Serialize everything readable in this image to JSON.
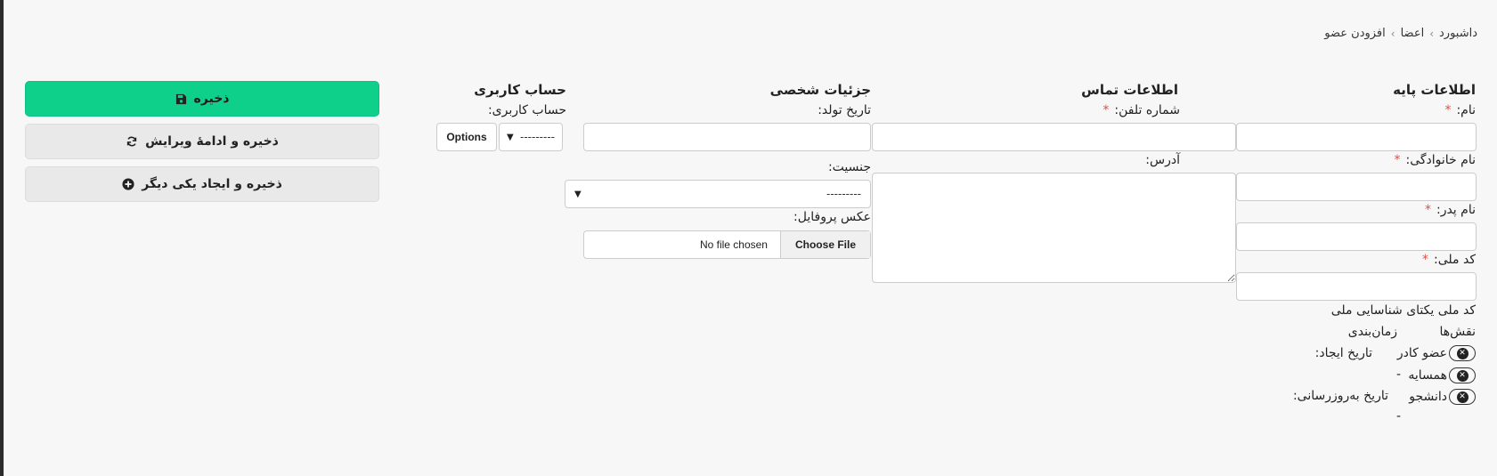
{
  "breadcrumb": {
    "items": [
      "داشبورد",
      "اعضا",
      "افزودن عضو"
    ],
    "separator": "›"
  },
  "sections": {
    "basic": "اطلاعات پایه",
    "contact": "اطلاعات تماس",
    "personal": "جزئیات شخصی",
    "account": "حساب کاربری"
  },
  "fields": {
    "first_name": {
      "label": "نام:",
      "value": ""
    },
    "last_name": {
      "label": "نام خانوادگی:",
      "value": ""
    },
    "father_name": {
      "label": "نام پدر:",
      "value": ""
    },
    "national_code": {
      "label": "کد ملی:",
      "value": "",
      "help": "کد ملی یکتای شناسایی ملی"
    },
    "phone": {
      "label": "شماره تلفن:",
      "value": ""
    },
    "address": {
      "label": "آدرس:",
      "value": ""
    },
    "birth_date": {
      "label": "تاریخ تولد:",
      "value": ""
    },
    "gender": {
      "label": "جنسیت:",
      "value": "---------"
    },
    "photo": {
      "label": "عکس پروفایل:",
      "choose": "Choose File",
      "status": "No file chosen"
    },
    "user_account": {
      "label": "حساب کاربری:",
      "value": "---------",
      "options": "Options"
    }
  },
  "required_mark": "*",
  "roles": {
    "title": "نقش‌ها",
    "items": [
      "عضو کادر",
      "همسایه",
      "دانشجو"
    ]
  },
  "timing": {
    "title": "زمان‌بندی",
    "created_label": "تاریخ ایجاد:",
    "created_value": "-",
    "updated_label": "تاریخ به‌روزرسانی:",
    "updated_value": "-"
  },
  "actions": {
    "save": "ذخیره",
    "save_continue": "ذخیره و ادامهٔ ویرایش",
    "save_add": "ذخیره و ایجاد یکی دیگر"
  },
  "colors": {
    "primary": "#0fd08b",
    "required": "#e74c3c"
  }
}
